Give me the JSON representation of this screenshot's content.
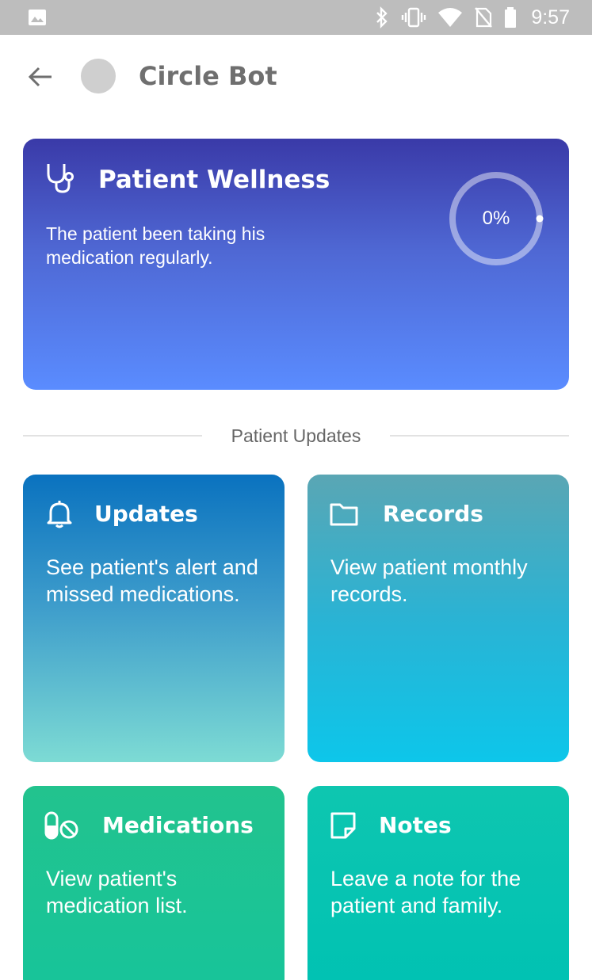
{
  "status_bar": {
    "time": "9:57",
    "icons": [
      "image-icon",
      "bluetooth-icon",
      "vibrate-icon",
      "wifi-icon",
      "no-sim-icon",
      "battery-icon"
    ]
  },
  "app_bar": {
    "title": "Circle Bot",
    "icons": [
      "back-arrow-icon",
      "avatar"
    ]
  },
  "wellness": {
    "title": "Patient Wellness",
    "description": "The patient been taking his medication regularly.",
    "progress_percent": 0,
    "progress_label": "0%",
    "icon": "stethoscope-icon"
  },
  "section": {
    "label": "Patient Updates"
  },
  "tiles": [
    {
      "title": "Updates",
      "description": "See patient's alert and missed medications.",
      "icon": "bell-icon"
    },
    {
      "title": "Records",
      "description": "View patient monthly records.",
      "icon": "folder-icon"
    },
    {
      "title": "Medications",
      "description": "View patient's medication list.",
      "icon": "pill-icon"
    },
    {
      "title": "Notes",
      "description": "Leave a note for the patient and family.",
      "icon": "note-icon"
    }
  ],
  "colors": {
    "status_bar": "#bdbdbd",
    "wellness_top": "#3a3aa8",
    "wellness_bottom": "#5a8cff",
    "updates_top": "#0a72bf",
    "records_bottom": "#0dc6ea",
    "medications": "#22c38e",
    "notes": "#0ec6b0"
  }
}
